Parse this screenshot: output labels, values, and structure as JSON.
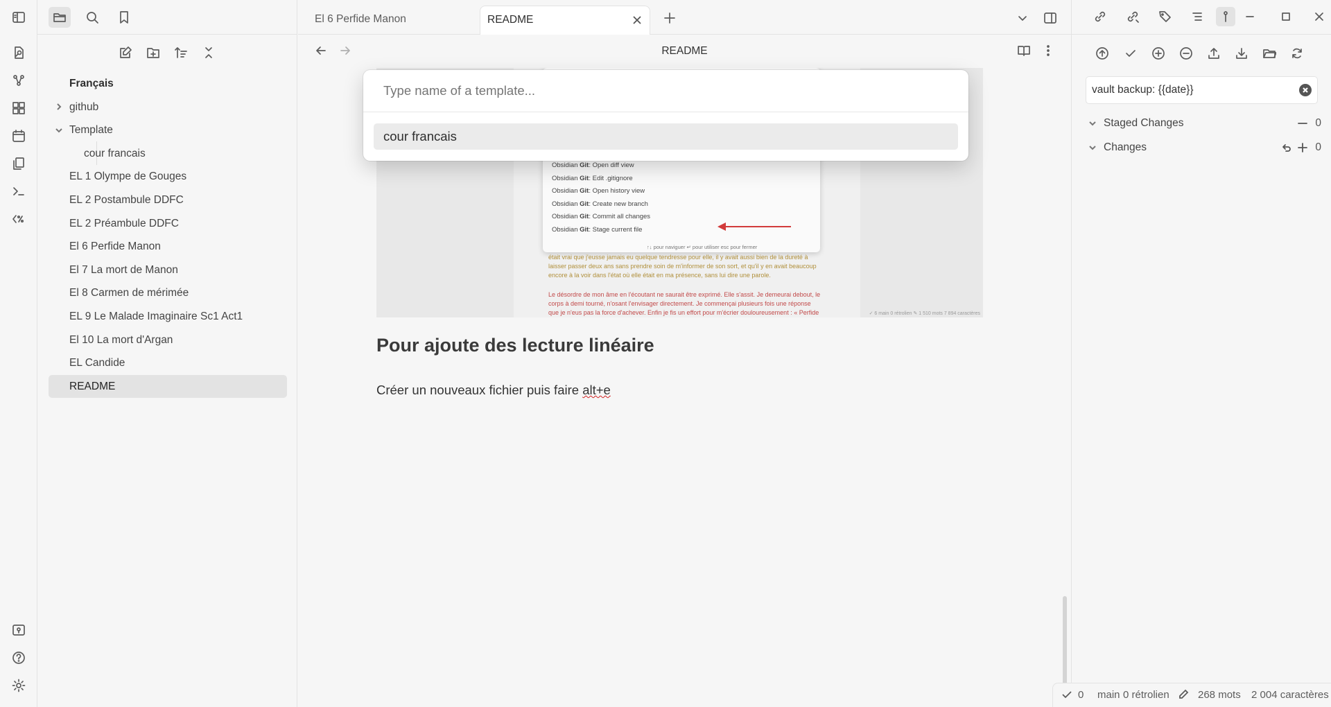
{
  "ribbon": {
    "icons": [
      "sidebar-toggle-icon",
      "open-quick-switcher-icon",
      "graph-icon",
      "canvas-icon",
      "calendar-icon",
      "files-icon",
      "terminal-icon",
      "templater-icon"
    ],
    "bottom_icons": [
      "vault-icon",
      "help-icon",
      "settings-icon"
    ]
  },
  "left_sidebar": {
    "tabs": [
      "folder-icon",
      "search-icon",
      "bookmark-icon"
    ],
    "actions": [
      "new-note-icon",
      "new-folder-icon",
      "sort-icon",
      "collapse-icon"
    ],
    "tree": [
      {
        "label": "Français",
        "type": "root"
      },
      {
        "label": "github",
        "type": "folder-collapsed"
      },
      {
        "label": "Template",
        "type": "folder-expanded"
      },
      {
        "label": "cour francais",
        "type": "child"
      },
      {
        "label": "EL 1 Olympe de Gouges",
        "type": "file"
      },
      {
        "label": "EL 2 Postambule DDFC",
        "type": "file"
      },
      {
        "label": "EL 2 Préambule DDFC",
        "type": "file"
      },
      {
        "label": "El 6 Perfide Manon",
        "type": "file"
      },
      {
        "label": "El 7 La mort de Manon",
        "type": "file"
      },
      {
        "label": "El 8 Carmen de mérimée",
        "type": "file"
      },
      {
        "label": "EL 9 Le Malade Imaginaire Sc1 Act1",
        "type": "file"
      },
      {
        "label": "El 10 La mort d'Argan",
        "type": "file"
      },
      {
        "label": "EL Candide",
        "type": "file"
      },
      {
        "label": "README",
        "type": "file-selected"
      }
    ]
  },
  "tabs": [
    {
      "label": "El 6 Perfide Manon",
      "active": false
    },
    {
      "label": "README",
      "active": true
    }
  ],
  "view_header": {
    "title": "README"
  },
  "modal": {
    "placeholder": "Type name of a template...",
    "suggestion": "cour francais"
  },
  "embedded_screenshot": {
    "menu_prefix": "Obsidian",
    "menu_brand": "Git",
    "menu_items": [
      ": Open diff view",
      ": Edit .gitignore",
      ": Open history view",
      ": Create new branch",
      ": Commit all changes",
      ": Stage current file"
    ],
    "menu_footer": "↑↓ pour naviguer   ↵ pour utiliser   esc pour fermer",
    "text_lines": [
      "était vrai que j'eusse jamais eu quelque tendresse pour elle, il y avait aussi bien de la dureté à",
      "laisser passer deux ans sans prendre soin de m'informer de son sort, et qu'il y en avait beaucoup",
      "encore à la voir dans l'état où elle était en ma présence, sans lui dire une parole.",
      "",
      "Le désordre de mon âme en l'écoutant ne saurait être exprimé. Elle s'assit. Je demeurai debout, le",
      "corps à demi tourné, n'osant l'envisager directement. Je commençai plusieurs fois une réponse",
      "que je n'eus pas la force d'achever. Enfin je fis un effort pour m'écrier douloureusement : « Perfide"
    ],
    "status": "✓ 6   main   0 rétrolien   ✎ 1 510 mots   7 894 caractères"
  },
  "content": {
    "heading": "Pour ajoute des lecture linéaire",
    "para_before": "Créer un nouveaux fichier puis faire ",
    "para_spell": "alt+e"
  },
  "git_panel": {
    "toolbar_icons": [
      "push-icon",
      "commit-icon",
      "stage-all-icon",
      "unstage-all-icon",
      "upload-icon",
      "pull-icon",
      "folder-open-icon",
      "refresh-icon"
    ],
    "commit_message": "vault backup: {{date}}",
    "staged": {
      "label": "Staged Changes",
      "count": "0"
    },
    "changes": {
      "label": "Changes",
      "count": "0"
    }
  },
  "statusbar": {
    "check_count": "0",
    "branch": "main",
    "backlinks": "0 rétrolien",
    "words": "268 mots",
    "chars": "2 004 caractères"
  },
  "colors": {
    "accent_arrow": "#d23b3b",
    "background": "#f6f6f6",
    "selected": "#e3e3e3"
  }
}
